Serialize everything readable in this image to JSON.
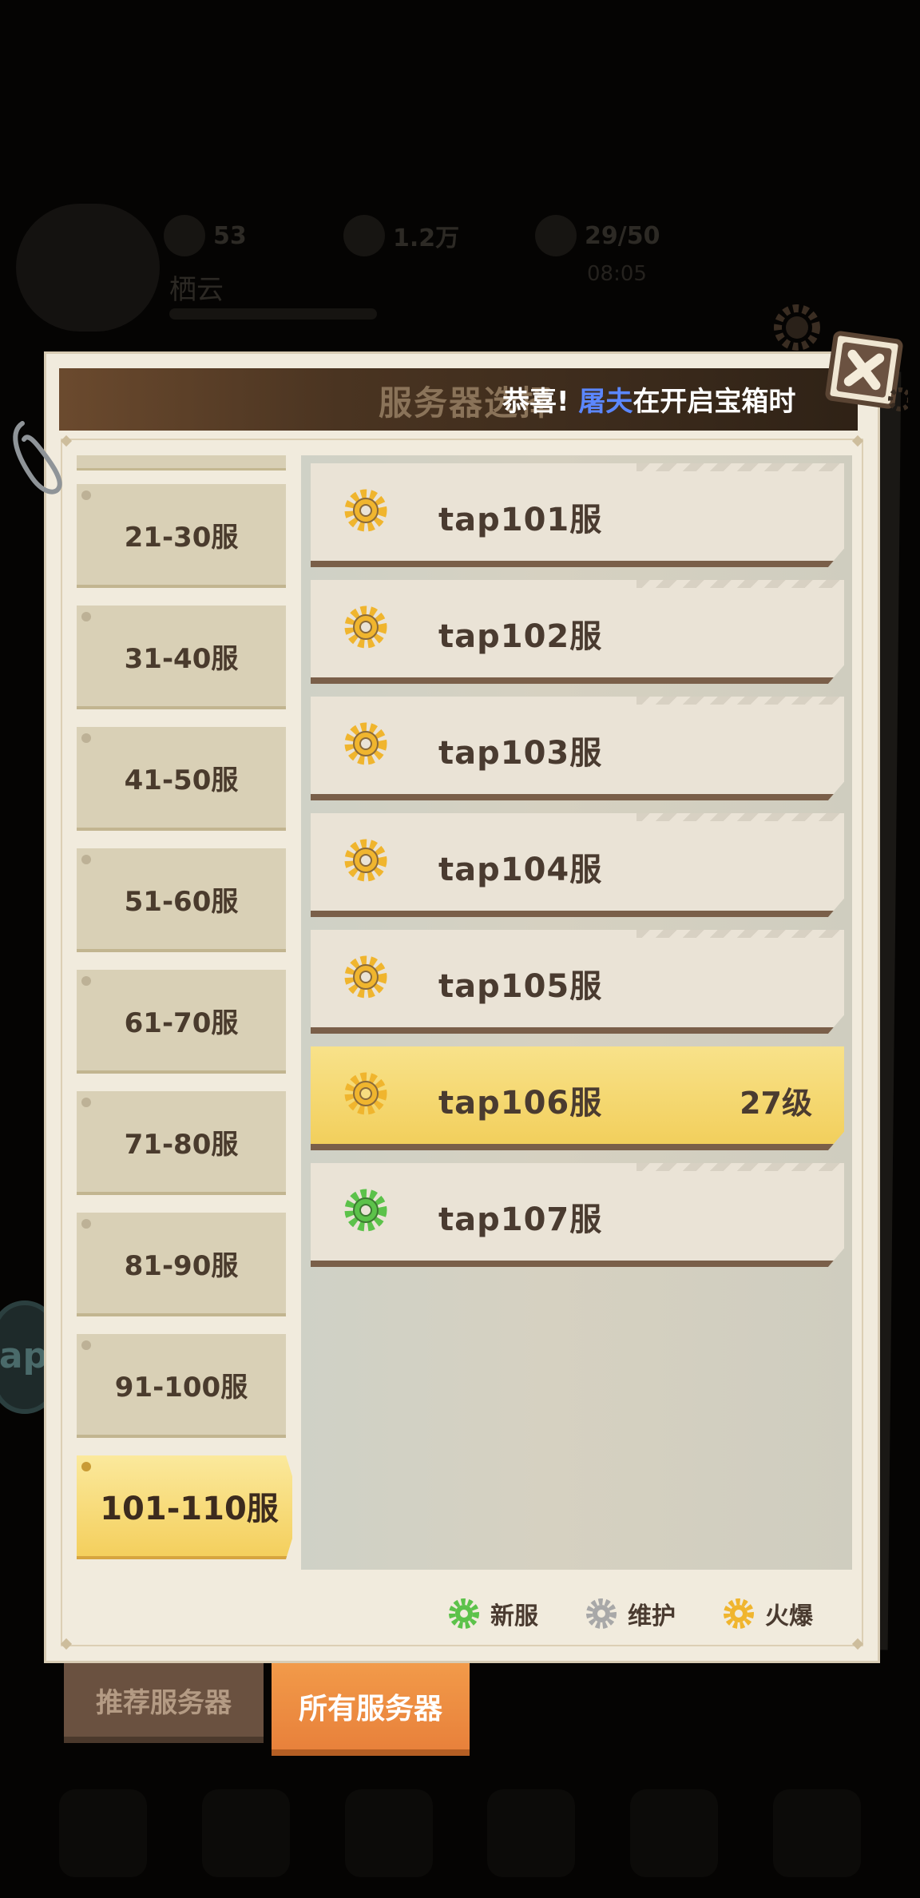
{
  "background": {
    "stats": [
      "53",
      "1.2万",
      "29/50"
    ],
    "player_name": "栖云",
    "timer": "08:05",
    "side_badge": "ap"
  },
  "header": {
    "title": "服务器选择",
    "marquee_prefix": "恭喜!",
    "marquee_player": "屠夫",
    "marquee_suffix": "在开启宝箱时"
  },
  "ranges": [
    {
      "label": "21-30服",
      "active": false
    },
    {
      "label": "31-40服",
      "active": false
    },
    {
      "label": "41-50服",
      "active": false
    },
    {
      "label": "51-60服",
      "active": false
    },
    {
      "label": "61-70服",
      "active": false
    },
    {
      "label": "71-80服",
      "active": false
    },
    {
      "label": "81-90服",
      "active": false
    },
    {
      "label": "91-100服",
      "active": false
    },
    {
      "label": "101-110服",
      "active": true
    }
  ],
  "servers": [
    {
      "name": "tap101服",
      "status": "hot",
      "level": "",
      "selected": false
    },
    {
      "name": "tap102服",
      "status": "hot",
      "level": "",
      "selected": false
    },
    {
      "name": "tap103服",
      "status": "hot",
      "level": "",
      "selected": false
    },
    {
      "name": "tap104服",
      "status": "hot",
      "level": "",
      "selected": false
    },
    {
      "name": "tap105服",
      "status": "hot",
      "level": "",
      "selected": false
    },
    {
      "name": "tap106服",
      "status": "hot",
      "level": "27级",
      "selected": true
    },
    {
      "name": "tap107服",
      "status": "new",
      "level": "",
      "selected": false
    }
  ],
  "legend": [
    {
      "label": "新服",
      "color": "#5cc24a",
      "icon": "gear-icon"
    },
    {
      "label": "维护",
      "color": "#a8a8a8",
      "icon": "gear-icon"
    },
    {
      "label": "火爆",
      "color": "#f0b52e",
      "icon": "gear-icon"
    }
  ],
  "tabs": {
    "recommended": "推荐服务器",
    "all": "所有服务器"
  },
  "colors": {
    "new": "#5cc24a",
    "maintenance": "#a8a8a8",
    "hot": "#f0b52e"
  }
}
